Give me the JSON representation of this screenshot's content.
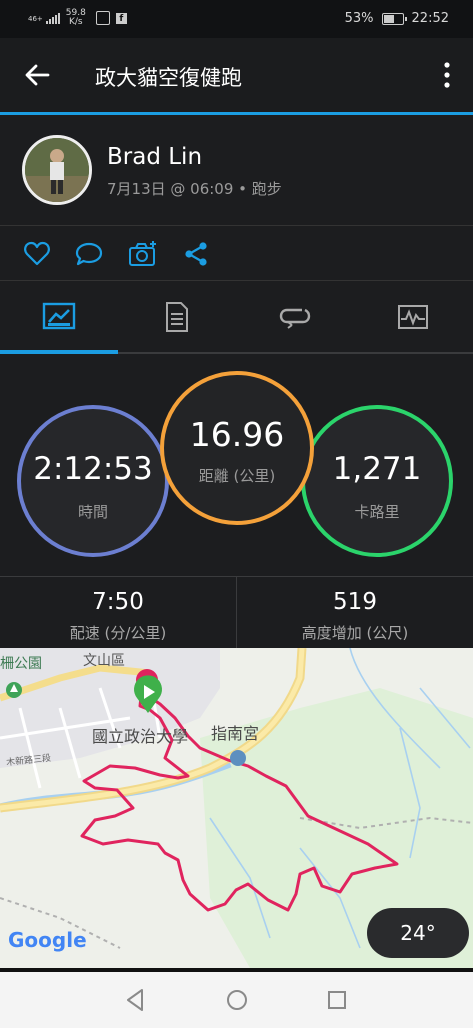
{
  "status_bar": {
    "signal_text": "46+",
    "speed_value": "59.8",
    "speed_unit": "K/s",
    "battery": "53%",
    "time": "22:52"
  },
  "header": {
    "title": "政大貓空復健跑",
    "back_icon": "arrow-left-icon",
    "more_icon": "more-vert-icon"
  },
  "profile": {
    "name": "Brad Lin",
    "meta": "7月13日 @ 06:09 • 跑步"
  },
  "actions": [
    "heart-icon",
    "comment-icon",
    "camera-icon",
    "share-icon"
  ],
  "tabs": [
    "stats-tab-icon",
    "details-tab-icon",
    "laps-tab-icon",
    "chart-tab-icon"
  ],
  "stats": {
    "time": {
      "value": "2:12:53",
      "label": "時間"
    },
    "distance": {
      "value": "16.96",
      "label": "距離 (公里)"
    },
    "calories": {
      "value": "1,271",
      "label": "卡路里"
    }
  },
  "secondary_stats": [
    {
      "value": "7:50",
      "label": "配速 (分/公里)"
    },
    {
      "value": "519",
      "label": "高度增加 (公尺)"
    }
  ],
  "map": {
    "labels": {
      "park": "柵公園",
      "district": "文山區",
      "university": "國立政治大學",
      "temple": "指南宮",
      "road": "木新路三段"
    },
    "google": "Google",
    "temperature": "24°"
  },
  "colors": {
    "accent": "#1b9de2",
    "time_ring": "#6c7fd1",
    "distance_ring": "#f4a13a",
    "calories_ring": "#2bd46b",
    "route": "#e0245e"
  }
}
